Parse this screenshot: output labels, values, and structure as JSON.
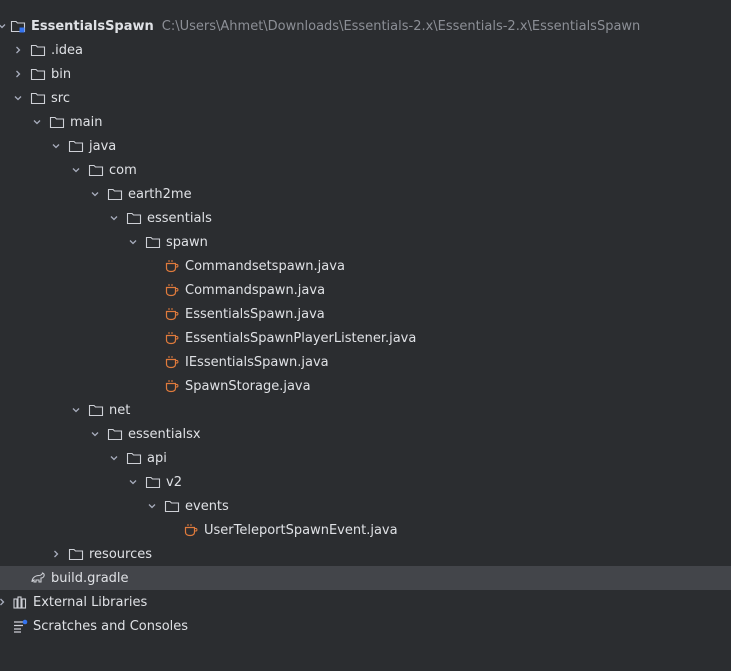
{
  "tree": {
    "project": {
      "name": "EssentialsSpawn",
      "path": "C:\\Users\\Ahmet\\Downloads\\Essentials-2.x\\Essentials-2.x\\EssentialsSpawn"
    },
    "rows": [
      {
        "label": "EssentialsSpawn",
        "type": "project",
        "expanded": true
      },
      {
        "label": ".idea",
        "type": "folder",
        "expanded": false
      },
      {
        "label": "bin",
        "type": "folder",
        "expanded": false
      },
      {
        "label": "src",
        "type": "folder",
        "expanded": true
      },
      {
        "label": "main",
        "type": "folder",
        "expanded": true
      },
      {
        "label": "java",
        "type": "folder",
        "expanded": true
      },
      {
        "label": "com",
        "type": "folder",
        "expanded": true
      },
      {
        "label": "earth2me",
        "type": "folder",
        "expanded": true
      },
      {
        "label": "essentials",
        "type": "folder",
        "expanded": true
      },
      {
        "label": "spawn",
        "type": "folder",
        "expanded": true
      },
      {
        "label": "Commandsetspawn.java",
        "type": "java"
      },
      {
        "label": "Commandspawn.java",
        "type": "java"
      },
      {
        "label": "EssentialsSpawn.java",
        "type": "java"
      },
      {
        "label": "EssentialsSpawnPlayerListener.java",
        "type": "java"
      },
      {
        "label": "IEssentialsSpawn.java",
        "type": "java"
      },
      {
        "label": "SpawnStorage.java",
        "type": "java"
      },
      {
        "label": "net",
        "type": "folder",
        "expanded": true
      },
      {
        "label": "essentialsx",
        "type": "folder",
        "expanded": true
      },
      {
        "label": "api",
        "type": "folder",
        "expanded": true
      },
      {
        "label": "v2",
        "type": "folder",
        "expanded": true
      },
      {
        "label": "events",
        "type": "folder",
        "expanded": true
      },
      {
        "label": "UserTeleportSpawnEvent.java",
        "type": "java"
      },
      {
        "label": "resources",
        "type": "folder",
        "expanded": false
      },
      {
        "label": "build.gradle",
        "type": "gradle",
        "selected": true
      },
      {
        "label": "External Libraries",
        "type": "libraries",
        "expanded": false
      },
      {
        "label": "Scratches and Consoles",
        "type": "scratches"
      }
    ]
  },
  "colors": {
    "background": "#2b2d30",
    "selection": "#43454a",
    "text": "#dfe1e5",
    "path_text": "#8c8f96",
    "java_icon": "#e07b3c",
    "folder_outline": "#ced0d6"
  },
  "icons": {
    "project": "project-folder-icon",
    "folder": "folder-icon",
    "java": "java-file-icon",
    "gradle": "gradle-icon",
    "libraries": "libraries-icon",
    "scratches": "scratches-icon"
  }
}
